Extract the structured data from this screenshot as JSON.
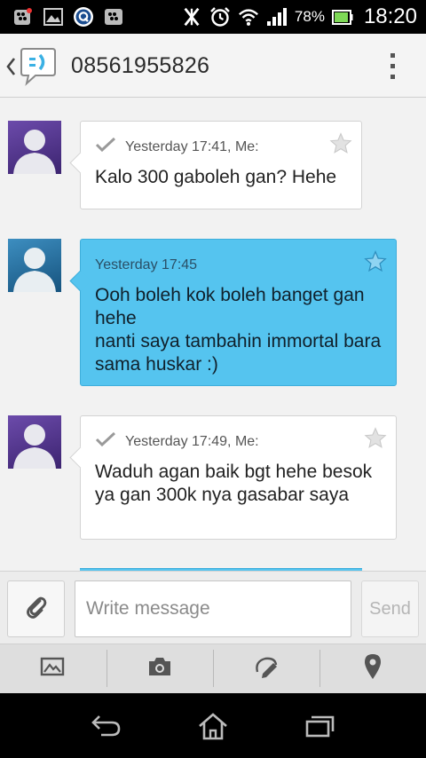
{
  "status_bar": {
    "battery_percent": "78%",
    "time": "18:20",
    "icons": [
      "bbm-notification-icon",
      "gallery-icon",
      "q-app-icon",
      "bbm-icon",
      "network-off-icon",
      "alarm-icon",
      "wifi-icon",
      "signal-icon",
      "battery-icon"
    ]
  },
  "header": {
    "contact_number": "08561955826",
    "icons": [
      "back-chevron-icon",
      "conversation-icon",
      "overflow-menu-icon"
    ]
  },
  "messages": [
    {
      "direction": "outgoing",
      "meta": "Yesterday 17:41, Me:",
      "text": "Kalo 300 gaboleh gan? Hehe",
      "starred": false
    },
    {
      "direction": "incoming",
      "meta": "Yesterday 17:45",
      "text": "Ooh boleh kok boleh banget gan hehe\nnanti saya tambahin immortal bara sama huskar :)",
      "starred": false
    },
    {
      "direction": "outgoing",
      "meta": "Yesterday 17:49, Me:",
      "text": "Waduh agan baik bgt hehe besok ya gan 300k nya gasabar saya",
      "starred": false
    }
  ],
  "compose": {
    "placeholder": "Write message",
    "value": "",
    "send_label": "Send"
  },
  "attachments": [
    "image-attach-icon",
    "camera-icon",
    "sketch-icon",
    "location-icon"
  ],
  "nav": [
    "back-icon",
    "home-icon",
    "recent-apps-icon"
  ],
  "colors": {
    "incoming_bubble": "#55c4ef",
    "outgoing_bubble": "#ffffff",
    "header_bg": "#f4f4f4",
    "conversation_bg": "#f2f2f2",
    "toolbar_bg": "#dedede"
  }
}
